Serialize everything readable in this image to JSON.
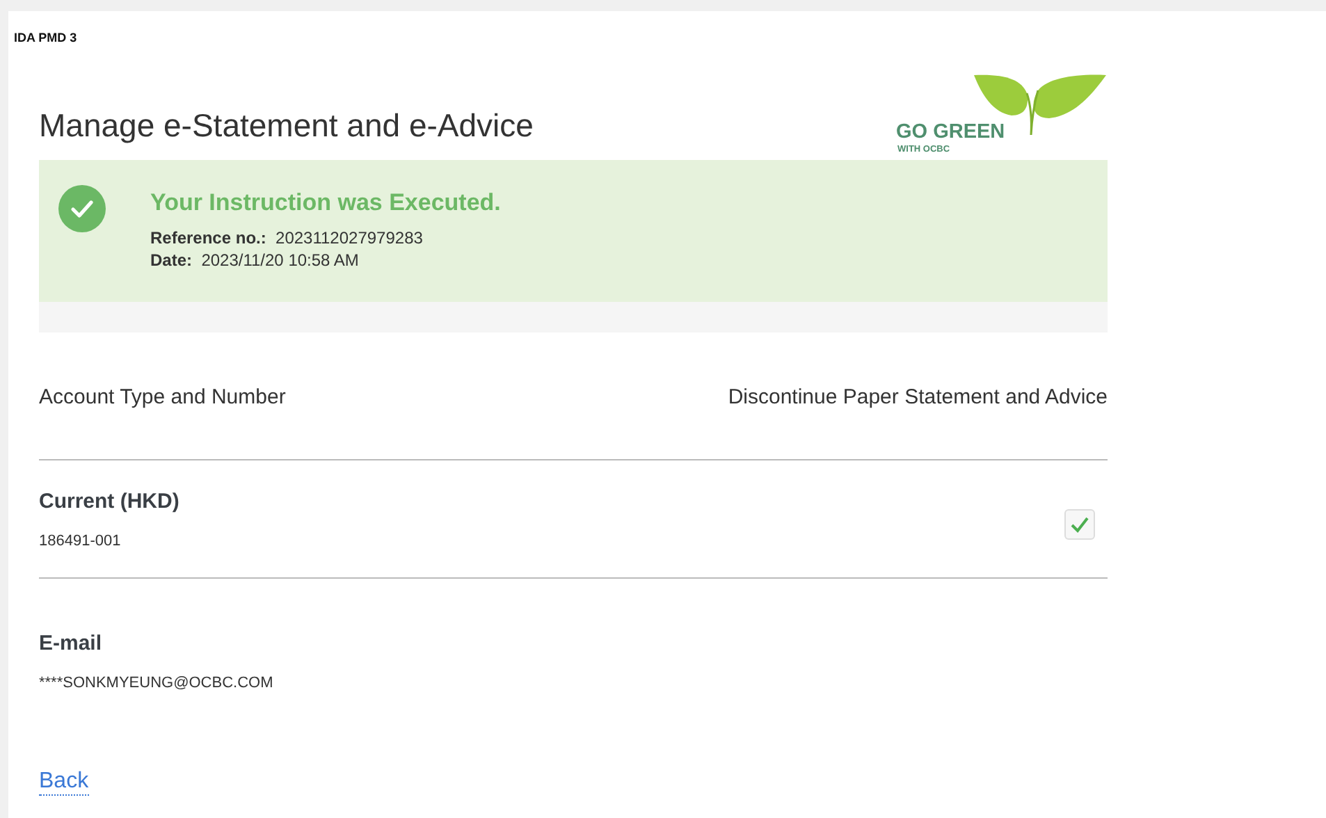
{
  "header": {
    "code": "IDA PMD 3"
  },
  "title": "Manage e-Statement and e-Advice",
  "logo": {
    "line1": "GO GREEN",
    "line2": "WITH OCBC"
  },
  "result": {
    "message": "Your Instruction was Executed.",
    "fields": [
      {
        "label": "Reference no.:",
        "value": "2023112027979283"
      },
      {
        "label": "Date:",
        "value": "2023/11/20 10:58 AM"
      }
    ]
  },
  "table": {
    "columns": [
      "Account Type and Number",
      "Discontinue Paper Statement and Advice"
    ],
    "rows": [
      {
        "type": "Current (HKD)",
        "number": "186491-001",
        "checked": true
      }
    ]
  },
  "email": {
    "label": "E-mail",
    "value": "****SONKMYEUNG@OCBC.COM"
  },
  "back_link": "Back"
}
